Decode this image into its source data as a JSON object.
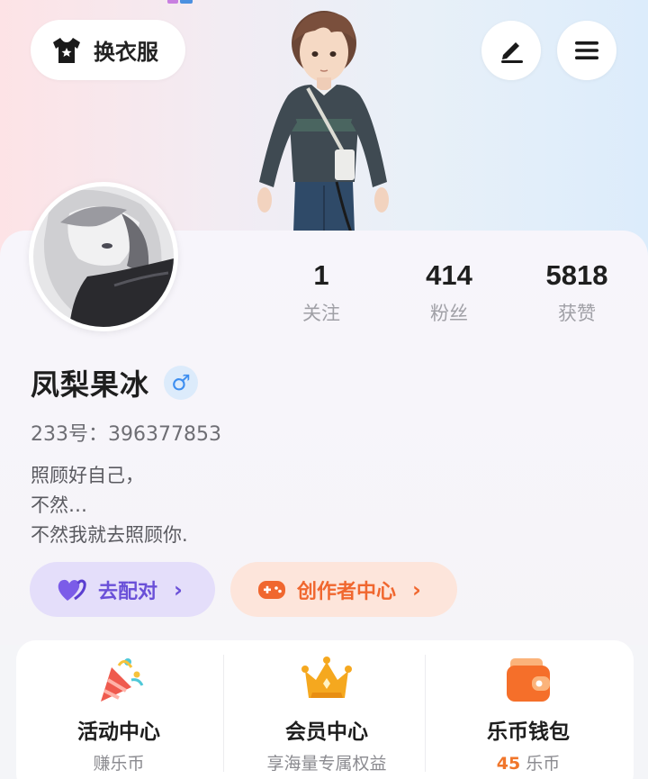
{
  "header": {
    "wardrobe_label": "换衣服",
    "icons": [
      "tshirt-icon",
      "pen-icon",
      "menu-icon"
    ]
  },
  "stats": [
    {
      "value": "1",
      "label": "关注"
    },
    {
      "value": "414",
      "label": "粉丝"
    },
    {
      "value": "5818",
      "label": "获赞"
    }
  ],
  "profile": {
    "name": "凤梨果冰",
    "gender_symbol": "♂",
    "uid": "233号：396377853",
    "bio": [
      "照顾好自己，",
      "不然…",
      "不然我就去照顾你."
    ]
  },
  "actions": {
    "pair_label": "去配对",
    "creator_label": "创作者中心",
    "chevron": "›"
  },
  "features": [
    {
      "title": "活动中心",
      "sub": "赚乐币"
    },
    {
      "title": "会员中心",
      "sub": "享海量专属权益"
    },
    {
      "title": "乐币钱包",
      "sub_value": "45",
      "sub_unit": " 乐币"
    }
  ],
  "colors": {
    "pair_accent": "#6a50d8",
    "creator_accent": "#f0672f",
    "gender_blue": "#3d8ef0",
    "coin_orange": "#f0762b"
  }
}
